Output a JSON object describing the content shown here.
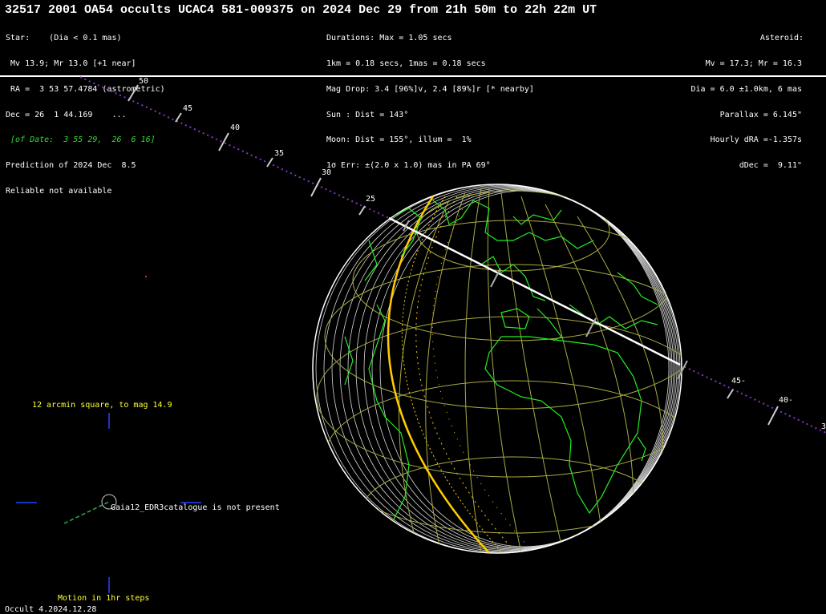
{
  "header": {
    "title": "32517 2001 OA54 occults UCAC4 581-009375 on 2024 Dec 29 from 21h 50m to 22h 22m UT"
  },
  "star_block": {
    "l1": "Star:    (Dia < 0.1 mas)",
    "l2": " Mv 13.9; Mr 13.0 [+1 near]",
    "l3": " RA =  3 53 57.4784 (astrometric)",
    "l4": "Dec = 26  1 44.169    ...",
    "l5": " [of Date:  3 55 29,  26  6 16]",
    "l6": "Prediction of 2024 Dec  8.5",
    "l7": "Reliable not available"
  },
  "event_block": {
    "l1": "Durations: Max = 1.05 secs",
    "l2": "1km = 0.18 secs, 1mas = 0.18 secs",
    "l3": "Mag Drop: 3.4 [96%]v, 2.4 [89%]r [* nearby]",
    "l4": "Sun : Dist = 143°",
    "l5": "Moon: Dist = 155°, illum =  1%",
    "l6": "1σ Err: ±(2.0 x 1.0) mas in PA 69°"
  },
  "asteroid_block": {
    "l1": "Asteroid:",
    "l2": "Mv = 17.3; Mr = 16.3",
    "l3": "Dia = 6.0 ±1.0km, 6 mas",
    "l4": "Parallax = 6.145\"",
    "l5": "Hourly dRA =-1.357s",
    "l6": "dDec =  9.11\""
  },
  "track_labels_left": [
    "50",
    "45",
    "40",
    "35",
    "30",
    "25"
  ],
  "track_labels_right": [
    "45-",
    "40-",
    "3"
  ],
  "starfield": {
    "caption": "12 arcmin square, to mag 14.9",
    "gaia_note": "Gaia12_EDR3catalogue is not present",
    "motion": "Motion in 1hr steps"
  },
  "footer": {
    "version": "Occult 4.2024.12.28"
  },
  "colors": {
    "track": "#8833cc",
    "path": "#ffffff",
    "coast": "#22ee22",
    "grid": "#aaaa44",
    "terminator": "#ffcc00",
    "limb": "#ffffff",
    "blue": "#2244ff"
  }
}
